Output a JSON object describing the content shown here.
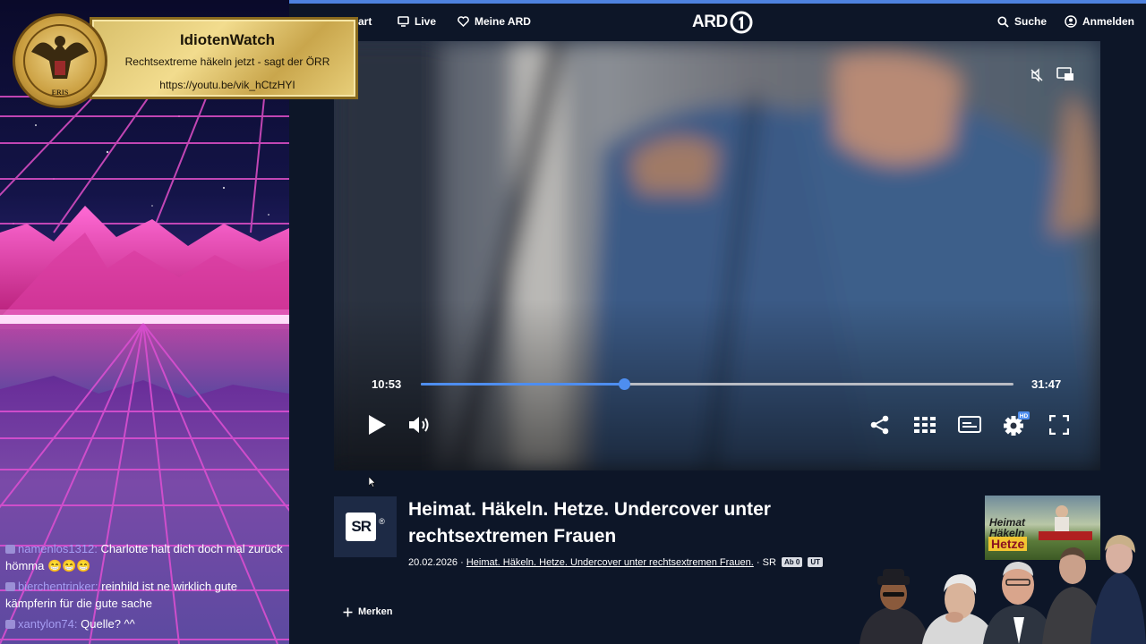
{
  "overlay": {
    "title": "IdiotenWatch",
    "subtitle": "Rechtsextreme häkeln jetzt - sagt der ÖRR",
    "link": "https://youtu.be/vik_hCtzHYI",
    "seal_text": "ERIS"
  },
  "chat": [
    {
      "user": "namenlos1312",
      "text": "Charlotte halt dich doch mal zurück hömma",
      "emoji": "😁😁😁"
    },
    {
      "user": "bierchentrinker",
      "text": "reinhild ist ne wirklich gute kämpferin für die gute sache",
      "emoji": ""
    },
    {
      "user": "xantylon74",
      "text": "Quelle? ^^",
      "emoji": ""
    }
  ],
  "nav": {
    "start": "tart",
    "live": "Live",
    "meine_ard": "Meine ARD",
    "logo": "ARD",
    "search": "Suche",
    "login": "Anmelden"
  },
  "player": {
    "current_time": "10:53",
    "duration": "31:47",
    "progress": 0.343,
    "hd_badge": "HD"
  },
  "video": {
    "channel_logo": "SR",
    "title": "Heimat. Häkeln. Hetze. Undercover unter rechtsextremen Frauen",
    "date": "20.02.2026",
    "series_link": "Heimat. Häkeln. Hetze. Undercover unter rechtsextremen Frauen.",
    "broadcaster": "SR",
    "age_tag": "Ab 0",
    "subtitle_tag": "UT"
  },
  "actions": {
    "merken": "Merken"
  },
  "thumbnail": {
    "line1": "Heimat",
    "line2": "Häkeln",
    "line3": "Hetze"
  },
  "colors": {
    "accent": "#4e8ef0",
    "background": "#0d1628",
    "banner_gold": "#e8cf7a"
  }
}
